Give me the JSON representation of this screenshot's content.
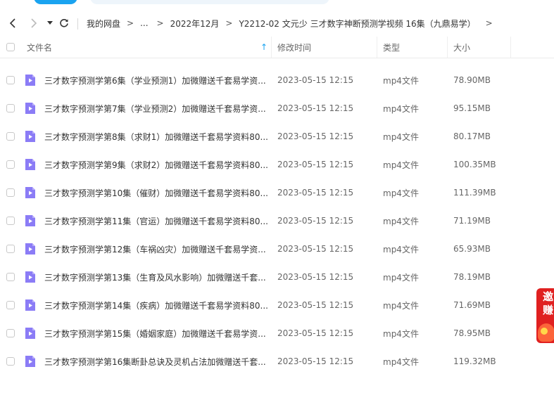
{
  "nav": {
    "breadcrumbs": [
      "我的网盘",
      "...",
      "2022年12月",
      "Y2212-02 文元少 三才数字神断预测学视频 16集（九鼎易学）"
    ],
    "separator": ">"
  },
  "table": {
    "headers": {
      "name": "文件名",
      "modified": "修改时间",
      "type": "类型",
      "size": "大小"
    },
    "sort_indicator": "↑",
    "rows": [
      {
        "name": "三才数字预测学第6集（学业预测1）加微赠送千套易学资...",
        "modified": "2023-05-15 12:15",
        "type": "mp4文件",
        "size": "78.90MB"
      },
      {
        "name": "三才数字预测学第7集（学业预测2）加微赠送千套易学资...",
        "modified": "2023-05-15 12:15",
        "type": "mp4文件",
        "size": "95.15MB"
      },
      {
        "name": "三才数字预测学第8集（求财1）加微赠送千套易学资料80...",
        "modified": "2023-05-15 12:15",
        "type": "mp4文件",
        "size": "80.17MB"
      },
      {
        "name": "三才数字预测学第9集（求财2）加微赠送千套易学资料80...",
        "modified": "2023-05-15 12:15",
        "type": "mp4文件",
        "size": "100.35MB"
      },
      {
        "name": "三才数字预测学第10集（催财）加微赠送千套易学资料80...",
        "modified": "2023-05-15 12:15",
        "type": "mp4文件",
        "size": "111.39MB"
      },
      {
        "name": "三才数字预测学第11集（官运）加微赠送千套易学资料80...",
        "modified": "2023-05-15 12:15",
        "type": "mp4文件",
        "size": "71.19MB"
      },
      {
        "name": "三才数字预测学第12集（车祸凶灾）加微赠送千套易学资...",
        "modified": "2023-05-15 12:15",
        "type": "mp4文件",
        "size": "65.93MB"
      },
      {
        "name": "三才数字预测学第13集（生育及风水影响）加微赠送千套...",
        "modified": "2023-05-15 12:15",
        "type": "mp4文件",
        "size": "78.19MB"
      },
      {
        "name": "三才数字预测学第14集（疾病）加微赠送千套易学资料80...",
        "modified": "2023-05-15 12:15",
        "type": "mp4文件",
        "size": "71.69MB"
      },
      {
        "name": "三才数字预测学第15集（婚姻家庭）加微赠送千套易学资...",
        "modified": "2023-05-15 12:15",
        "type": "mp4文件",
        "size": "78.95MB"
      },
      {
        "name": "三才数字预测学第16集断卦总诀及灵机占法加微赠送千套...",
        "modified": "2023-05-15 12:15",
        "type": "mp4文件",
        "size": "119.32MB"
      }
    ]
  },
  "ad": {
    "text": [
      "邀",
      "赚"
    ]
  },
  "colors": {
    "accent": "#1aa3f0",
    "file_icon": "#8b7cf6",
    "ad_red": "#e02020"
  },
  "icons": {
    "back": "chevron-left-icon",
    "forward": "chevron-right-icon",
    "dropdown": "caret-down-icon",
    "refresh": "refresh-icon",
    "file": "video-file-icon"
  }
}
